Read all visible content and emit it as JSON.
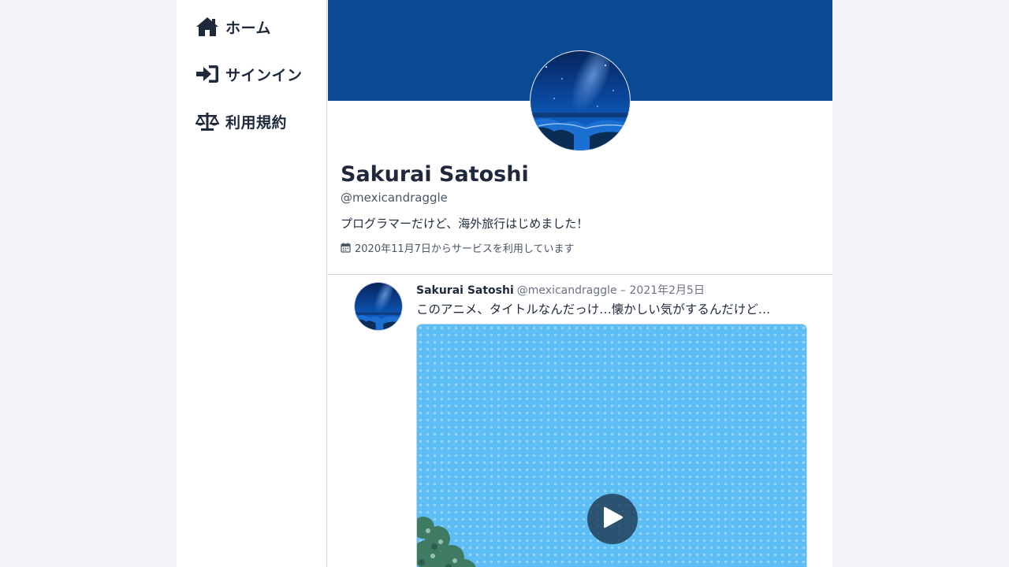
{
  "sidebar": {
    "items": [
      {
        "label": "ホーム",
        "icon": "home-icon"
      },
      {
        "label": "サインイン",
        "icon": "sign-in-icon"
      },
      {
        "label": "利用規約",
        "icon": "scale-icon"
      }
    ]
  },
  "profile": {
    "name": "Sakurai Satoshi",
    "handle": "@mexicandraggle",
    "bio": "プログラマーだけど、海外旅行はじめました！",
    "joined": "2020年11月7日からサービスを利用しています",
    "joined_icon": "calendar-icon",
    "banner_color": "#0a4a93"
  },
  "tweet": {
    "author": "Sakurai Satoshi",
    "meta": "@mexicandraggle – 2021年2月5日",
    "text": "このアニメ、タイトルなんだっけ…懐かしい気がするんだけど…",
    "media_icon": "play-icon"
  }
}
